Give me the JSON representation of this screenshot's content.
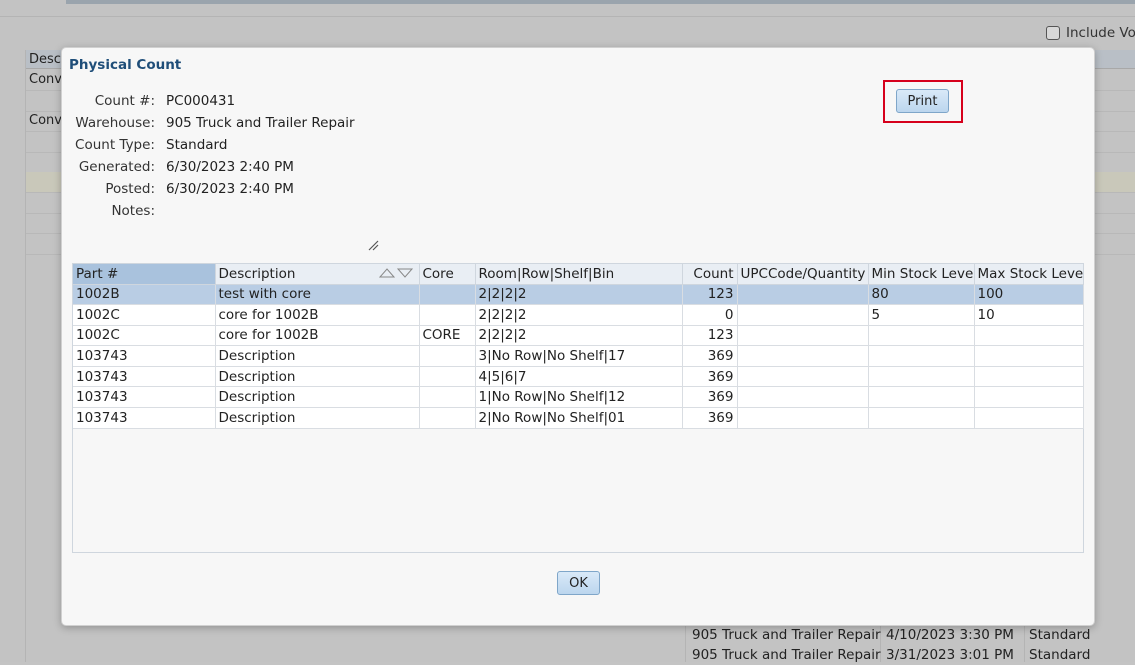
{
  "background": {
    "include_checkbox_label": "Include Voi",
    "grid_header": "Descr",
    "rows": [
      "Conve",
      "",
      "Conve"
    ],
    "bottom_rows": [
      {
        "warehouse": "905 Truck and Trailer Repair",
        "date": "4/10/2023 3:30 PM",
        "type": "Standard"
      },
      {
        "warehouse": "905 Truck and Trailer Repair",
        "date": "3/31/2023 3:01 PM",
        "type": "Standard"
      }
    ]
  },
  "modal": {
    "title": "Physical Count",
    "fields": {
      "count_no": {
        "label": "Count #:",
        "value": "PC000431"
      },
      "warehouse": {
        "label": "Warehouse:",
        "value": "905 Truck and Trailer Repair"
      },
      "count_type": {
        "label": "Count Type:",
        "value": "Standard"
      },
      "generated": {
        "label": "Generated:",
        "value": "6/30/2023 2:40 PM"
      },
      "posted": {
        "label": "Posted:",
        "value": "6/30/2023 2:40 PM"
      },
      "notes": {
        "label": "Notes:",
        "value": ""
      }
    },
    "print_label": "Print",
    "ok_label": "OK",
    "grid": {
      "columns": [
        "Part #",
        "Description",
        "Core",
        "Room|Row|Shelf|Bin",
        "Count",
        "UPCCode/Quantity",
        "Min Stock Level",
        "Max Stock Level"
      ],
      "rows": [
        {
          "part": "1002B",
          "description": "test with core",
          "core": "",
          "location": "2|2|2|2",
          "count": "123",
          "upc": "",
          "min": "80",
          "max": "100",
          "selected": true
        },
        {
          "part": "1002C",
          "description": "core for 1002B",
          "core": "",
          "location": "2|2|2|2",
          "count": "0",
          "upc": "",
          "min": "5",
          "max": "10"
        },
        {
          "part": "1002C",
          "description": "core for 1002B",
          "core": "CORE",
          "location": "2|2|2|2",
          "count": "123",
          "upc": "",
          "min": "",
          "max": ""
        },
        {
          "part": "103743",
          "description": "Description",
          "core": "",
          "location": "3|No Row|No Shelf|17",
          "count": "369",
          "upc": "",
          "min": "",
          "max": ""
        },
        {
          "part": "103743",
          "description": "Description",
          "core": "",
          "location": "4|5|6|7",
          "count": "369",
          "upc": "",
          "min": "",
          "max": ""
        },
        {
          "part": "103743",
          "description": "Description",
          "core": "",
          "location": "1|No Row|No Shelf|12",
          "count": "369",
          "upc": "",
          "min": "",
          "max": ""
        },
        {
          "part": "103743",
          "description": "Description",
          "core": "",
          "location": "2|No Row|No Shelf|01",
          "count": "369",
          "upc": "",
          "min": "",
          "max": ""
        }
      ]
    }
  },
  "colors": {
    "accent_title": "#1f4e79",
    "highlight_box": "#d6001c",
    "selected_row": "#b9cde4",
    "button_bg": "#bcd6ee"
  }
}
